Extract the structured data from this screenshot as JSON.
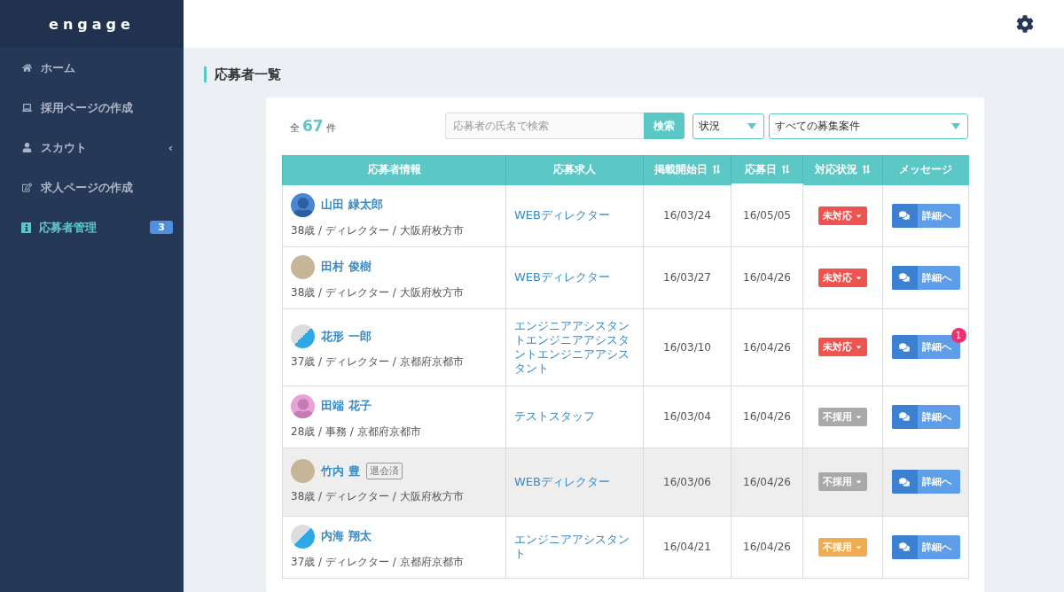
{
  "sidebar": {
    "logo": "engage",
    "items": [
      {
        "label": "ホーム",
        "selected": false
      },
      {
        "label": "採用ページの作成",
        "selected": false
      },
      {
        "label": "スカウト",
        "selected": false,
        "chevron": "‹"
      },
      {
        "label": "求人ページの作成",
        "selected": false
      },
      {
        "label": "応募者管理",
        "selected": true,
        "badge": "3"
      }
    ]
  },
  "page": {
    "title": "応募者一覧"
  },
  "summary": {
    "prefix": "全",
    "count": "67",
    "suffix": "件"
  },
  "search": {
    "placeholder": "応募者の氏名で検索",
    "button": "検索"
  },
  "filters": [
    {
      "value": "状況"
    },
    {
      "value": "すべての募集案件"
    }
  ],
  "table": {
    "columns": [
      {
        "label": "応募者情報",
        "sortable": false,
        "sorted": false
      },
      {
        "label": "応募求人",
        "sortable": false,
        "sorted": false
      },
      {
        "label": "掲載開始日",
        "sortable": true,
        "sorted": false
      },
      {
        "label": "応募日",
        "sortable": true,
        "sorted": true
      },
      {
        "label": "対応状況",
        "sortable": true,
        "sorted": false
      },
      {
        "label": "メッセージ",
        "sortable": false,
        "sorted": false
      }
    ],
    "rows": [
      {
        "kind": "male",
        "name": "山田 緑太郎",
        "details": "38歳 / ディレクター / 大阪府枚方市",
        "job": "WEBディレクター",
        "posted": "16/03/24",
        "applied": "16/05/05",
        "status": {
          "label": "未対応",
          "color": "#ef5350"
        },
        "action": "詳細へ",
        "shaded": false
      },
      {
        "kind": "photo",
        "name": "田村 俊樹",
        "details": "38歳 / ディレクター / 大阪府枚方市",
        "job": "WEBディレクター",
        "posted": "16/03/27",
        "applied": "16/04/26",
        "status": {
          "label": "未対応",
          "color": "#ef5350"
        },
        "action": "詳細へ",
        "shaded": false
      },
      {
        "kind": "logo",
        "name": "花形 一郎",
        "details": "37歳 / ディレクター / 京都府京都市",
        "job": "エンジニアアシスタントエンジニアアシスタントエンジニアアシスタント",
        "posted": "16/03/10",
        "applied": "16/04/26",
        "status": {
          "label": "未対応",
          "color": "#ef5350"
        },
        "action": "詳細へ",
        "unread": "1",
        "shaded": false
      },
      {
        "kind": "female",
        "name": "田端 花子",
        "details": "28歳 / 事務 / 京都府京都市",
        "job": "テストスタッフ",
        "posted": "16/03/04",
        "applied": "16/04/26",
        "status": {
          "label": "不採用",
          "color": "#a9a9a9"
        },
        "action": "詳細へ",
        "shaded": false
      },
      {
        "kind": "photo",
        "name": "竹内 豊",
        "tag": "退会済",
        "details": "38歳 / ディレクター / 大阪府枚方市",
        "job": "WEBディレクター",
        "posted": "16/03/06",
        "applied": "16/04/26",
        "status": {
          "label": "不採用",
          "color": "#a9a9a9"
        },
        "action": "詳細へ",
        "shaded": true
      },
      {
        "kind": "logo",
        "name": "内海 翔太",
        "details": "37歳 / ディレクター / 京都府京都市",
        "job": "エンジニアアシスタント",
        "posted": "16/04/21",
        "applied": "16/04/26",
        "status": {
          "label": "不採用",
          "color": "#f0ad4e"
        },
        "action": "詳細へ",
        "shaded": false
      }
    ]
  }
}
